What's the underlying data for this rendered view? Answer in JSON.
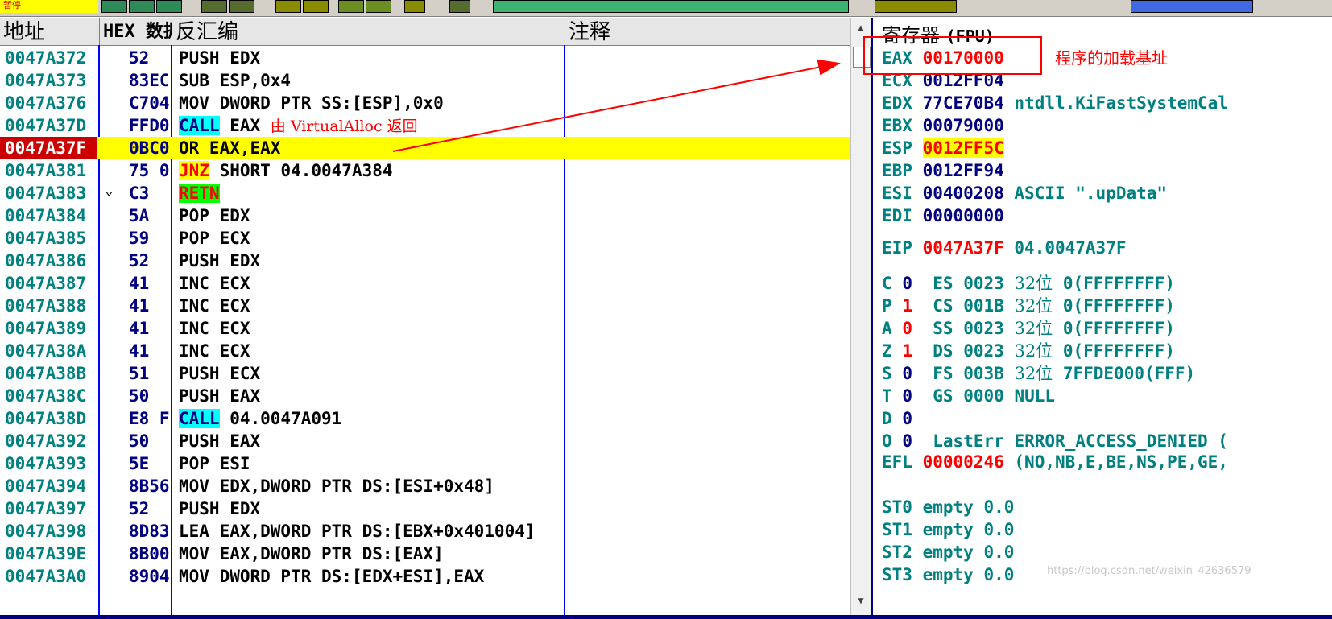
{
  "toolbar": {
    "label": "暂停"
  },
  "cpu": {
    "headers": {
      "addr": "地址",
      "hex": "HEX 数据",
      "asm": "反汇编",
      "comment": "注释"
    },
    "rows": [
      {
        "addr": "0047A372",
        "hex": "52",
        "asm": "PUSH EDX"
      },
      {
        "addr": "0047A373",
        "hex": "83EC",
        "asm": "SUB ESP,0x4"
      },
      {
        "addr": "0047A376",
        "hex": "C704",
        "asm": "MOV DWORD PTR SS:[ESP],0x0"
      },
      {
        "addr": "0047A37D",
        "hex": "FFD0",
        "asm_op": "CALL",
        "asm_rest": " EAX ",
        "note": "由 VirtualAlloc 返回"
      },
      {
        "addr": "0047A37F",
        "hex": "0BC0",
        "asm": "OR EAX,EAX",
        "selected": true
      },
      {
        "addr": "0047A381",
        "hex": "75 0",
        "asm_op": "JNZ",
        "asm_rest": " SHORT 04.0047A384"
      },
      {
        "addr": "0047A383",
        "hex": "C3",
        "asm_op": "RETN",
        "asm_rest": ""
      },
      {
        "addr": "0047A384",
        "hex": "5A",
        "asm": "POP EDX"
      },
      {
        "addr": "0047A385",
        "hex": "59",
        "asm": "POP ECX"
      },
      {
        "addr": "0047A386",
        "hex": "52",
        "asm": "PUSH EDX"
      },
      {
        "addr": "0047A387",
        "hex": "41",
        "asm": "INC ECX"
      },
      {
        "addr": "0047A388",
        "hex": "41",
        "asm": "INC ECX"
      },
      {
        "addr": "0047A389",
        "hex": "41",
        "asm": "INC ECX"
      },
      {
        "addr": "0047A38A",
        "hex": "41",
        "asm": "INC ECX"
      },
      {
        "addr": "0047A38B",
        "hex": "51",
        "asm": "PUSH ECX"
      },
      {
        "addr": "0047A38C",
        "hex": "50",
        "asm": "PUSH EAX"
      },
      {
        "addr": "0047A38D",
        "hex": "E8 F",
        "asm_op": "CALL",
        "asm_rest": " 04.0047A091"
      },
      {
        "addr": "0047A392",
        "hex": "50",
        "asm": "PUSH EAX"
      },
      {
        "addr": "0047A393",
        "hex": "5E",
        "asm": "POP ESI"
      },
      {
        "addr": "0047A394",
        "hex": "8B56",
        "asm": "MOV EDX,DWORD PTR DS:[ESI+0x48]"
      },
      {
        "addr": "0047A397",
        "hex": "52",
        "asm": "PUSH EDX"
      },
      {
        "addr": "0047A398",
        "hex": "8D83",
        "asm": "LEA EAX,DWORD PTR DS:[EBX+0x401004]"
      },
      {
        "addr": "0047A39E",
        "hex": "8B00",
        "asm": "MOV EAX,DWORD PTR DS:[EAX]"
      },
      {
        "addr": "0047A3A0",
        "hex": "8904",
        "asm": "MOV DWORD PTR DS:[EDX+ESI],EAX"
      }
    ]
  },
  "registers": {
    "title": "寄存器 ",
    "title_fpu": "(FPU)",
    "gp": [
      {
        "name": "EAX",
        "value": "00170000",
        "changed": true,
        "text": ""
      },
      {
        "name": "ECX",
        "value": "0012FF04",
        "changed": false,
        "text": ""
      },
      {
        "name": "EDX",
        "value": "77CE70B4",
        "changed": false,
        "text": "ntdll.KiFastSystemCal"
      },
      {
        "name": "EBX",
        "value": "00079000",
        "changed": false,
        "text": ""
      },
      {
        "name": "ESP",
        "value": "0012FF5C",
        "changed": true,
        "text": ""
      },
      {
        "name": "EBP",
        "value": "0012FF94",
        "changed": false,
        "text": ""
      },
      {
        "name": "ESI",
        "value": "00400208",
        "changed": false,
        "text": "ASCII \".upData\""
      },
      {
        "name": "EDI",
        "value": "00000000",
        "changed": false,
        "text": ""
      }
    ],
    "eip": {
      "name": "EIP",
      "value": "0047A37F",
      "text": "04.0047A37F"
    },
    "flags": [
      {
        "name": "C",
        "value": "0",
        "changed": false,
        "seg": "ES",
        "segval": "0023",
        "bits": "32位",
        "limit": "0(FFFFFFFF)"
      },
      {
        "name": "P",
        "value": "1",
        "changed": true,
        "seg": "CS",
        "segval": "001B",
        "bits": "32位",
        "limit": "0(FFFFFFFF)"
      },
      {
        "name": "A",
        "value": "0",
        "changed": true,
        "seg": "SS",
        "segval": "0023",
        "bits": "32位",
        "limit": "0(FFFFFFFF)"
      },
      {
        "name": "Z",
        "value": "1",
        "changed": true,
        "seg": "DS",
        "segval": "0023",
        "bits": "32位",
        "limit": "0(FFFFFFFF)"
      },
      {
        "name": "S",
        "value": "0",
        "changed": false,
        "seg": "FS",
        "segval": "003B",
        "bits": "32位",
        "limit": "7FFDE000(FFF)"
      },
      {
        "name": "T",
        "value": "0",
        "changed": false,
        "seg": "GS",
        "segval": "0000",
        "bits": "",
        "limit": "NULL"
      },
      {
        "name": "D",
        "value": "0",
        "changed": false,
        "seg": "",
        "segval": "",
        "bits": "",
        "limit": ""
      },
      {
        "name": "O",
        "value": "0",
        "changed": false,
        "seg": "LastErr",
        "segval": "ERROR_ACCESS_DENIED (",
        "bits": "",
        "limit": ""
      }
    ],
    "efl": {
      "name": "EFL",
      "value": "00000246",
      "text": "(NO,NB,E,BE,NS,PE,GE,"
    },
    "fpu": [
      {
        "name": "ST0",
        "text": "empty 0.0"
      },
      {
        "name": "ST1",
        "text": "empty 0.0"
      },
      {
        "name": "ST2",
        "text": "empty 0.0"
      },
      {
        "name": "ST3",
        "text": "empty 0.0"
      }
    ]
  },
  "annotation": {
    "text": "程序的加载基址"
  },
  "watermark": "https://blog.csdn.net/weixin_42636579",
  "colors": {
    "selection": "#ffff00",
    "highlight_red": "#ff0000",
    "addr_teal": "#008080",
    "navy": "#000080"
  }
}
